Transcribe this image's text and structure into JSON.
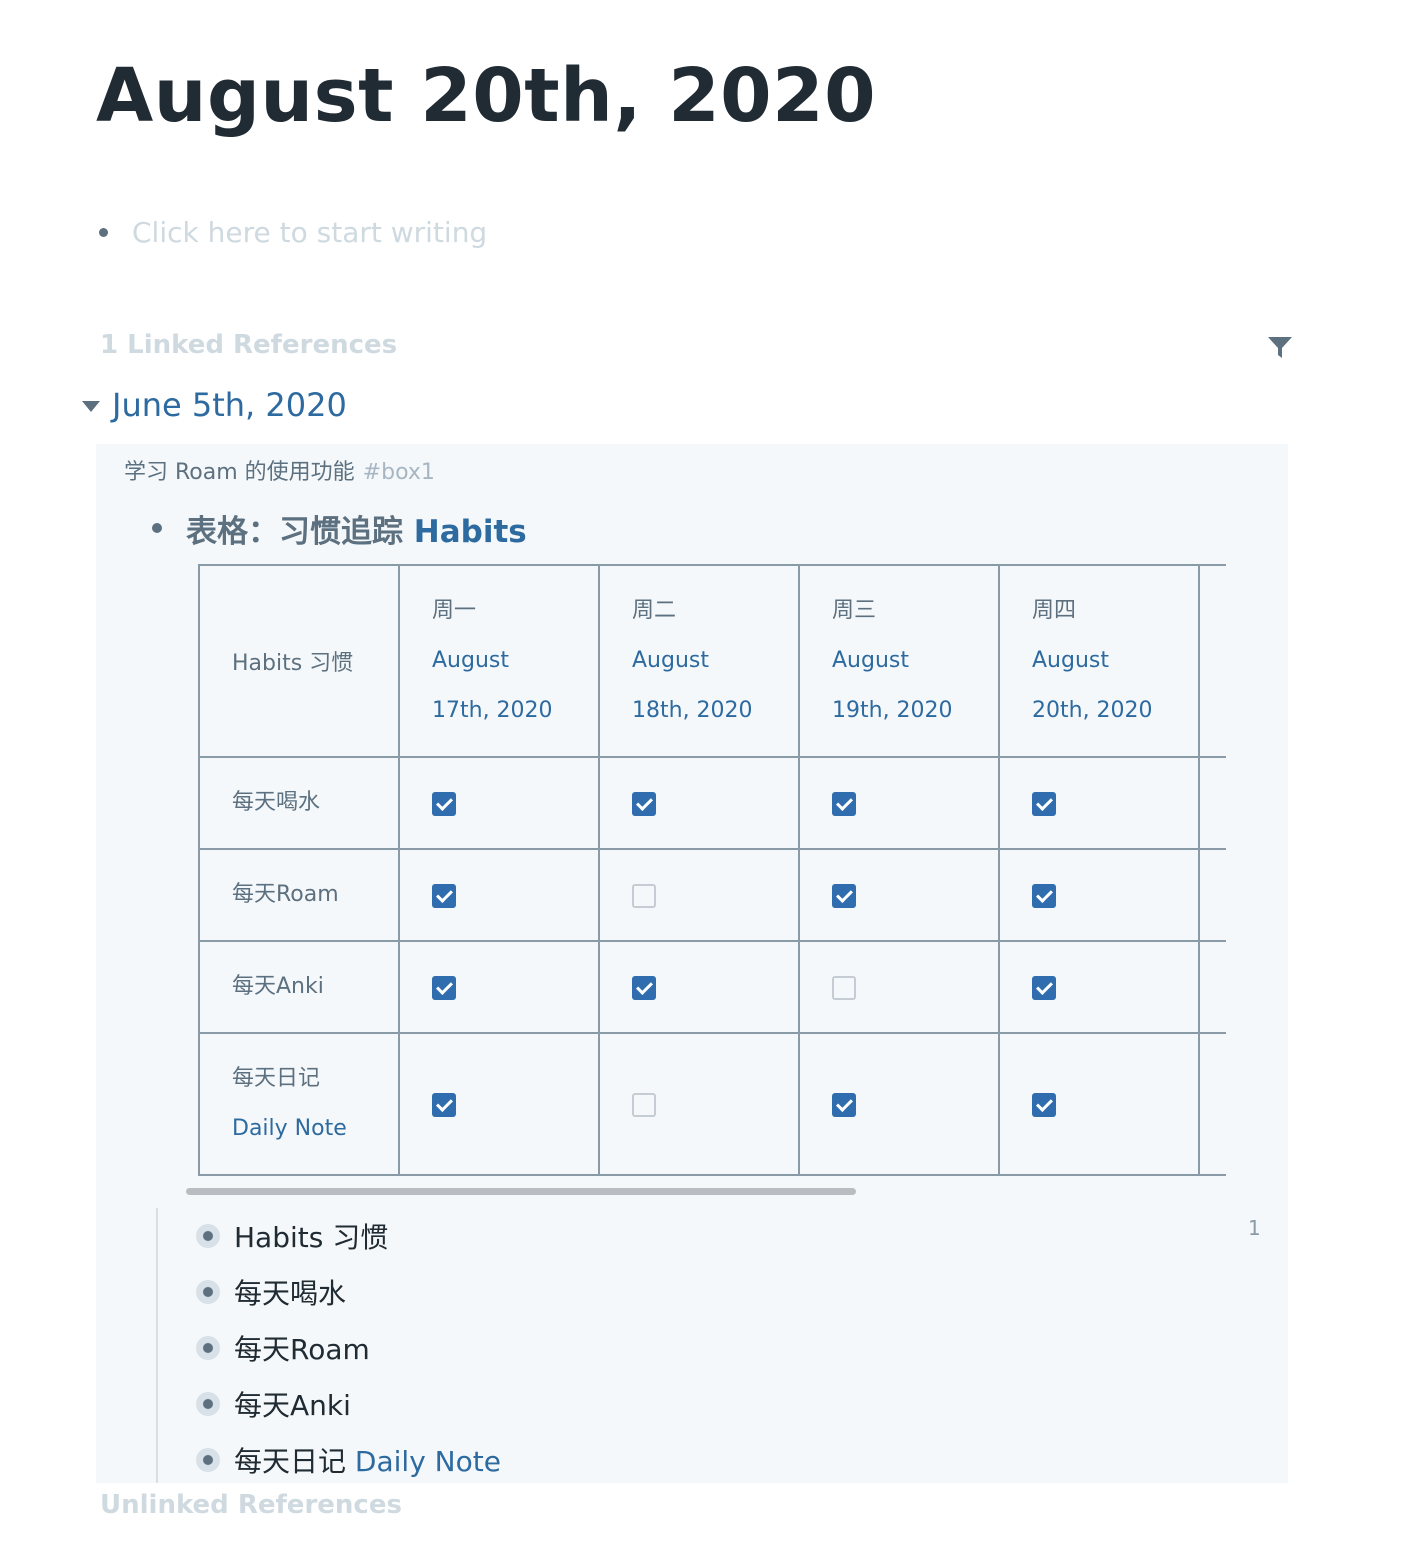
{
  "page": {
    "title": "August 20th, 2020",
    "placeholder": "Click here to start writing"
  },
  "linked_refs": {
    "heading": "1 Linked References",
    "filter_icon": "filter-icon",
    "group_title": "June 5th, 2020",
    "breadcrumb": "学习 Roam 的使用功能",
    "breadcrumb_tag": "#box1",
    "block_title": "表格：习惯追踪",
    "block_title_link": "Habits",
    "ref_count": "1"
  },
  "table": {
    "header_label": "Habits 习惯",
    "days": [
      {
        "weekday": "周一",
        "date_line1": "August",
        "date_line2": "17th, 2020"
      },
      {
        "weekday": "周二",
        "date_line1": "August",
        "date_line2": "18th, 2020"
      },
      {
        "weekday": "周三",
        "date_line1": "August",
        "date_line2": "19th, 2020"
      },
      {
        "weekday": "周四",
        "date_line1": "August",
        "date_line2": "20th, 2020"
      }
    ],
    "rows": [
      {
        "name": "每天喝水",
        "link": "",
        "checks": [
          true,
          true,
          true,
          true
        ]
      },
      {
        "name": "每天Roam",
        "link": "",
        "checks": [
          true,
          false,
          true,
          true
        ]
      },
      {
        "name": "每天Anki",
        "link": "",
        "checks": [
          true,
          true,
          false,
          true
        ]
      },
      {
        "name": "每天日记",
        "link": "Daily Note",
        "checks": [
          true,
          false,
          true,
          true
        ]
      }
    ]
  },
  "children": [
    {
      "text": "Habits 习惯",
      "link": ""
    },
    {
      "text": "每天喝水",
      "link": ""
    },
    {
      "text": "每天Roam",
      "link": ""
    },
    {
      "text": "每天Anki",
      "link": ""
    },
    {
      "text": "每天日记",
      "link": "Daily Note"
    }
  ],
  "unlinked_refs": {
    "heading": "Unlinked References"
  },
  "colors": {
    "link": "#2d6aa0",
    "checkbox_on": "#2f6dae",
    "muted_heading": "#ced9e0",
    "panel_bg": "#f5f8fa"
  }
}
